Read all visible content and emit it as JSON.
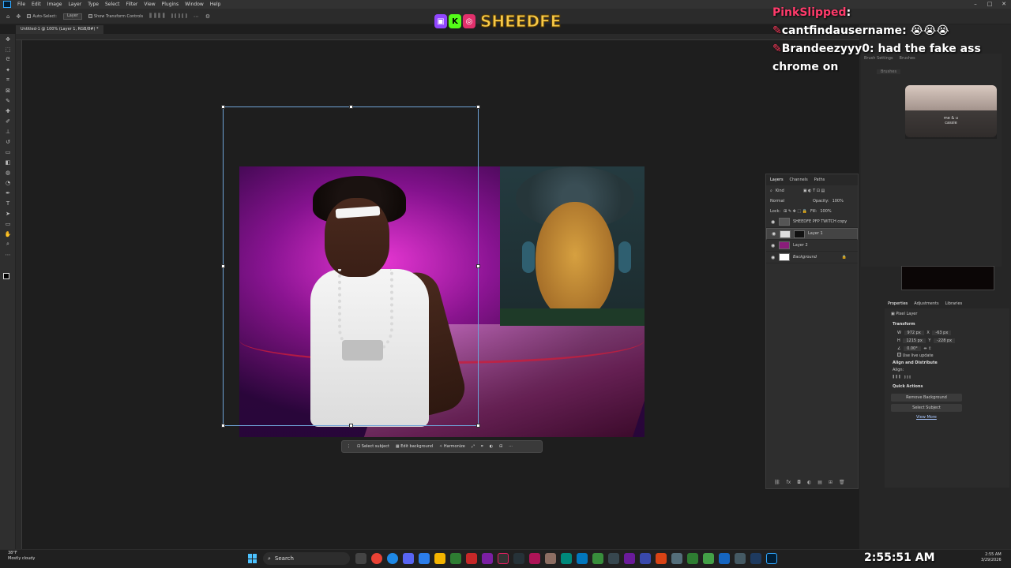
{
  "menubar": {
    "items": [
      "File",
      "Edit",
      "Image",
      "Layer",
      "Type",
      "Select",
      "Filter",
      "View",
      "Plugins",
      "Window",
      "Help"
    ]
  },
  "optionsbar": {
    "auto_select_label": "Auto-Select:",
    "auto_select_value": "Layer",
    "transform_controls_label": "Show Transform Controls"
  },
  "document": {
    "tab_title": "Untitled-1 @ 100% (Layer 1, RGB/8#) *"
  },
  "contextbar": {
    "select_subject": "Select subject",
    "edit_background": "Edit background",
    "harmonize": "Harmonize"
  },
  "overlay": {
    "streamer_name": "SHEEDFE",
    "chat": [
      {
        "user": "PinkSlipped",
        "message": ":",
        "emoji": ""
      },
      {
        "user": "cantfindausername",
        "message": ":",
        "emoji": "😭😭😭"
      },
      {
        "user": "Brandeezyyy0",
        "message": ": had the fake ass chrome on",
        "emoji": ""
      }
    ]
  },
  "brushes": {
    "panel_tabs": [
      "Brush Settings",
      "Brushes"
    ],
    "brushes_button": "Brushes",
    "player_title": "me & u",
    "player_sub": "cassie"
  },
  "layers": {
    "tabs": [
      "Layers",
      "Channels",
      "Paths"
    ],
    "filter": "Kind",
    "blend_mode": "Normal",
    "opacity_label": "Opacity:",
    "opacity": "100%",
    "lock_label": "Lock:",
    "fill_label": "Fill:",
    "fill": "100%",
    "items": [
      {
        "name": "SHEEDFE PFP TWITCH copy",
        "selected": false
      },
      {
        "name": "Layer 1",
        "selected": true
      },
      {
        "name": "Layer 2",
        "selected": false
      },
      {
        "name": "Background",
        "selected": false
      }
    ]
  },
  "properties": {
    "tabs": [
      "Properties",
      "Adjustments",
      "Libraries"
    ],
    "kind": "Pixel Layer",
    "transform_label": "Transform",
    "w": "972 px",
    "x": "-63 px",
    "h": "1215 px",
    "y": "-228 px",
    "angle": "0.00°",
    "live_update": "Use live update",
    "align_label": "Align and Distribute",
    "align_sub": "Align:",
    "quick_actions": "Quick Actions",
    "remove_bg": "Remove Background",
    "select_subject": "Select Subject",
    "view_more": "View More"
  },
  "taskbar": {
    "temp": "38°F",
    "weather": "Mostly cloudy",
    "search_placeholder": "Search",
    "time": "2:55 AM",
    "date": "3/29/2026"
  },
  "stream_clock": "2:55:51 AM",
  "colors": {
    "accent": "#31a8ff",
    "streamer_name": "#f7c948",
    "chat_badge": "#ff3b5c"
  }
}
